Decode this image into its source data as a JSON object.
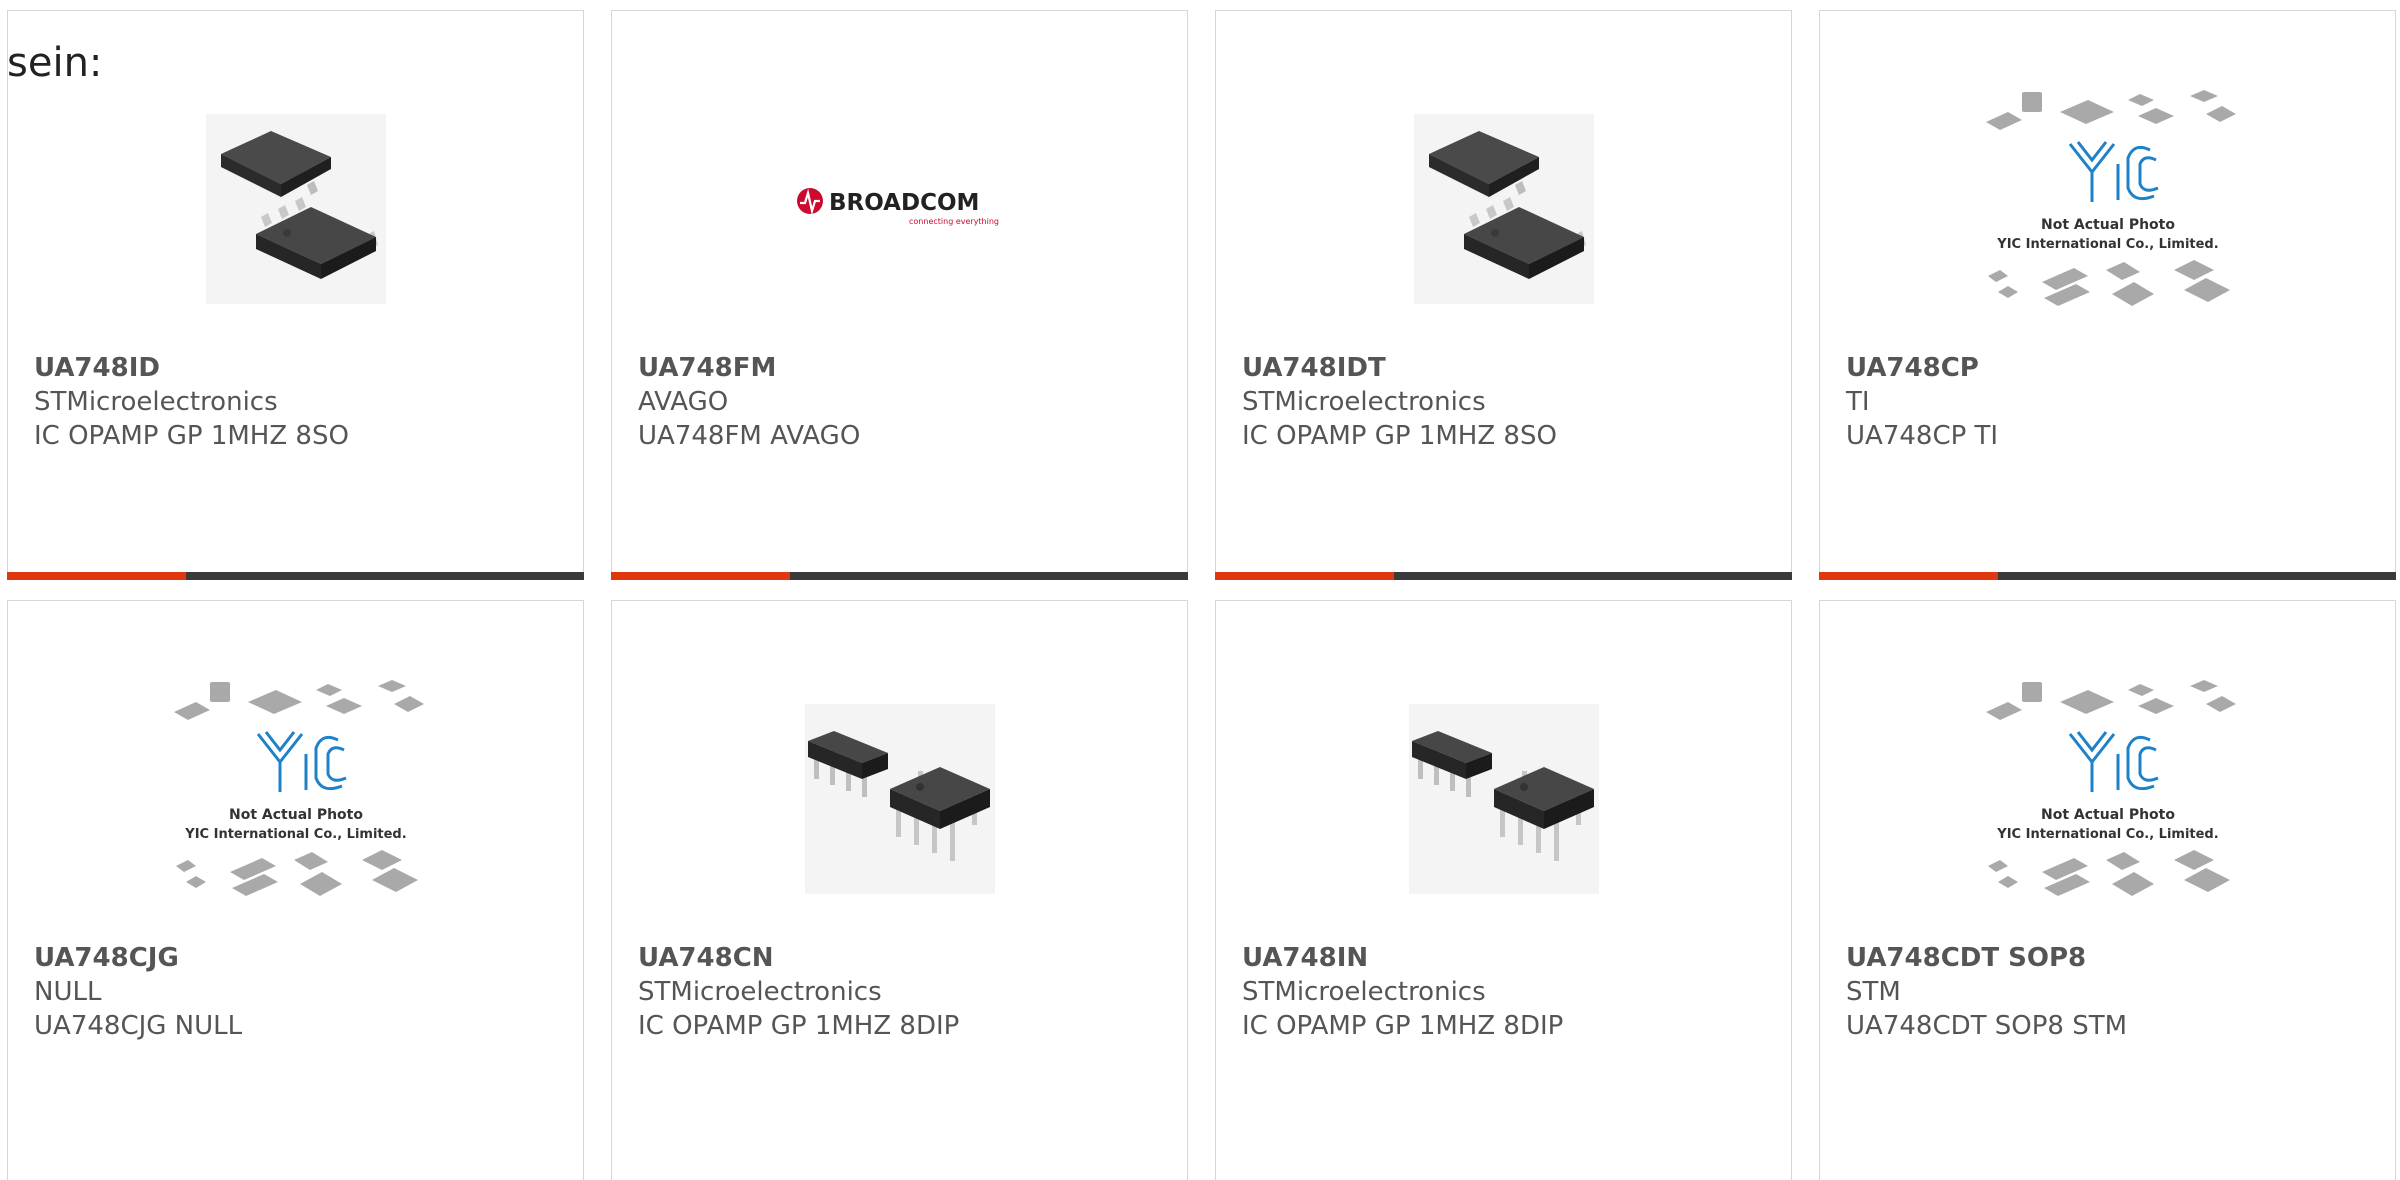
{
  "intro_text": "sein:",
  "colors": {
    "accent": "#e0380e",
    "bar": "#3a3a3a",
    "text": "#555555",
    "border": "#d6d6d6"
  },
  "cards": [
    {
      "part_number": "UA748ID",
      "manufacturer": "STMicroelectronics",
      "description": "IC OPAMP GP 1MHZ 8SO",
      "image": "soic-8-chip-image"
    },
    {
      "part_number": "UA748FM",
      "manufacturer": "AVAGO",
      "description": "UA748FM AVAGO",
      "image": "broadcom-logo-image",
      "logo_text": "BROADCOM",
      "logo_tagline": "connecting everything"
    },
    {
      "part_number": "UA748IDT",
      "manufacturer": "STMicroelectronics",
      "description": "IC OPAMP GP 1MHZ 8SO",
      "image": "soic-8-chip-image"
    },
    {
      "part_number": "UA748CP",
      "manufacturer": "TI",
      "description": "UA748CP TI",
      "image": "yic-placeholder-image",
      "placeholder_line1": "Not Actual Photo",
      "placeholder_line2": "YIC International Co., Limited."
    },
    {
      "part_number": "UA748CJG",
      "manufacturer": "NULL",
      "description": "UA748CJG NULL",
      "image": "yic-placeholder-image",
      "placeholder_line1": "Not Actual Photo",
      "placeholder_line2": "YIC International Co., Limited."
    },
    {
      "part_number": "UA748CN",
      "manufacturer": "STMicroelectronics",
      "description": "IC OPAMP GP 1MHZ 8DIP",
      "image": "dip-8-chip-image"
    },
    {
      "part_number": "UA748IN",
      "manufacturer": "STMicroelectronics",
      "description": "IC OPAMP GP 1MHZ 8DIP",
      "image": "dip-8-chip-image"
    },
    {
      "part_number": "UA748CDT SOP8",
      "manufacturer": "STM",
      "description": "UA748CDT SOP8 STM",
      "image": "yic-placeholder-image",
      "placeholder_line1": "Not Actual Photo",
      "placeholder_line2": "YIC International Co., Limited."
    }
  ]
}
